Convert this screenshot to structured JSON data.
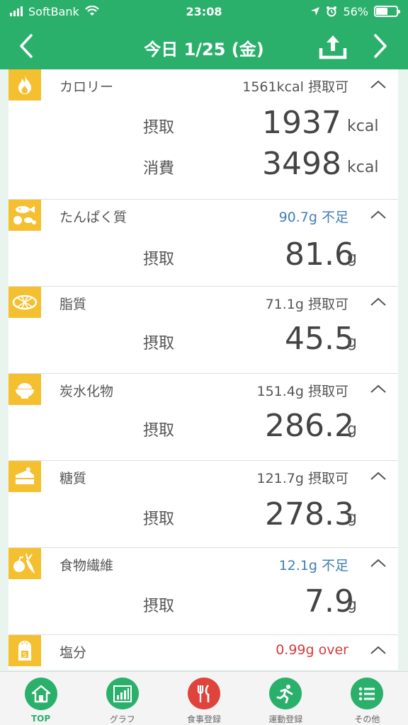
{
  "status_bar": {
    "carrier": "SoftBank",
    "time": "23:08",
    "battery": "56%",
    "battery_level": 0.56
  },
  "header": {
    "title": "今日 1/25 (金)"
  },
  "sections": [
    {
      "label": "カロリー",
      "status": "1561kcal 摂取可",
      "status_type": "normal",
      "icon": "flame-icon",
      "rows": [
        {
          "label": "摂取",
          "value": "1937",
          "unit": "kcal"
        },
        {
          "label": "消費",
          "value": "3498",
          "unit": "kcal"
        }
      ]
    },
    {
      "label": "たんぱく質",
      "status": "90.7g 不足",
      "status_type": "warn",
      "icon": "protein-food-icon",
      "rows": [
        {
          "label": "摂取",
          "value": "81.6",
          "unit": "g"
        }
      ]
    },
    {
      "label": "脂質",
      "status": "71.1g 摂取可",
      "status_type": "normal",
      "icon": "fat-icon",
      "rows": [
        {
          "label": "摂取",
          "value": "45.5",
          "unit": "g"
        }
      ]
    },
    {
      "label": "炭水化物",
      "status": "151.4g 摂取可",
      "status_type": "normal",
      "icon": "rice-bowl-icon",
      "rows": [
        {
          "label": "摂取",
          "value": "286.2",
          "unit": "g"
        }
      ]
    },
    {
      "label": "糖質",
      "status": "121.7g 摂取可",
      "status_type": "normal",
      "icon": "cake-icon",
      "rows": [
        {
          "label": "摂取",
          "value": "278.3",
          "unit": "g"
        }
      ]
    },
    {
      "label": "食物繊維",
      "status": "12.1g 不足",
      "status_type": "warn",
      "icon": "vegetable-icon",
      "rows": [
        {
          "label": "摂取",
          "value": "7.9",
          "unit": "g"
        }
      ]
    },
    {
      "label": "塩分",
      "status": "0.99g over",
      "status_type": "over",
      "icon": "salt-shaker-icon",
      "rows": []
    }
  ],
  "tabs": [
    {
      "label": "TOP",
      "icon": "home-icon",
      "active": true
    },
    {
      "label": "グラフ",
      "icon": "bar-chart-icon",
      "active": false
    },
    {
      "label": "食事登録",
      "icon": "fork-knife-icon",
      "active": false
    },
    {
      "label": "運動登録",
      "icon": "running-icon",
      "active": false
    },
    {
      "label": "その他",
      "icon": "list-icon",
      "active": false
    }
  ],
  "colors": {
    "brand_green": "#2bb06c",
    "icon_yellow": "#f5c02f",
    "warn_blue": "#3f7fb7",
    "over_red": "#d43c3c",
    "meal_red": "#e0433c"
  }
}
